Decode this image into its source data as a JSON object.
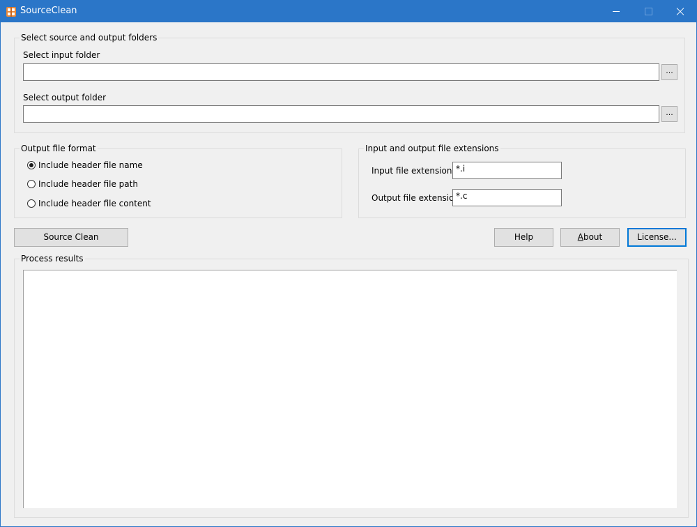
{
  "window": {
    "title": "SourceClean",
    "accent_color": "#2b76c8",
    "icon": "app-logo-icon"
  },
  "folders": {
    "legend": "Select source and output folders",
    "input_label": "Select input folder",
    "input_value": "",
    "output_label": "Select output folder",
    "output_value": "",
    "browse_label": "..."
  },
  "format": {
    "legend": "Output file format",
    "options": [
      {
        "label": "Include header file name",
        "selected": true
      },
      {
        "label": "Include header file path",
        "selected": false
      },
      {
        "label": "Include header file content",
        "selected": false
      }
    ]
  },
  "extensions": {
    "legend": "Input and output file extensions",
    "input_label": "Input file extension:",
    "input_value": "*.i",
    "output_label": "Output file extension:",
    "output_value": "*.c"
  },
  "buttons": {
    "source_clean": "Source Clean",
    "help": "Help",
    "about": "About",
    "license": "License..."
  },
  "results": {
    "legend": "Process results",
    "content": ""
  }
}
